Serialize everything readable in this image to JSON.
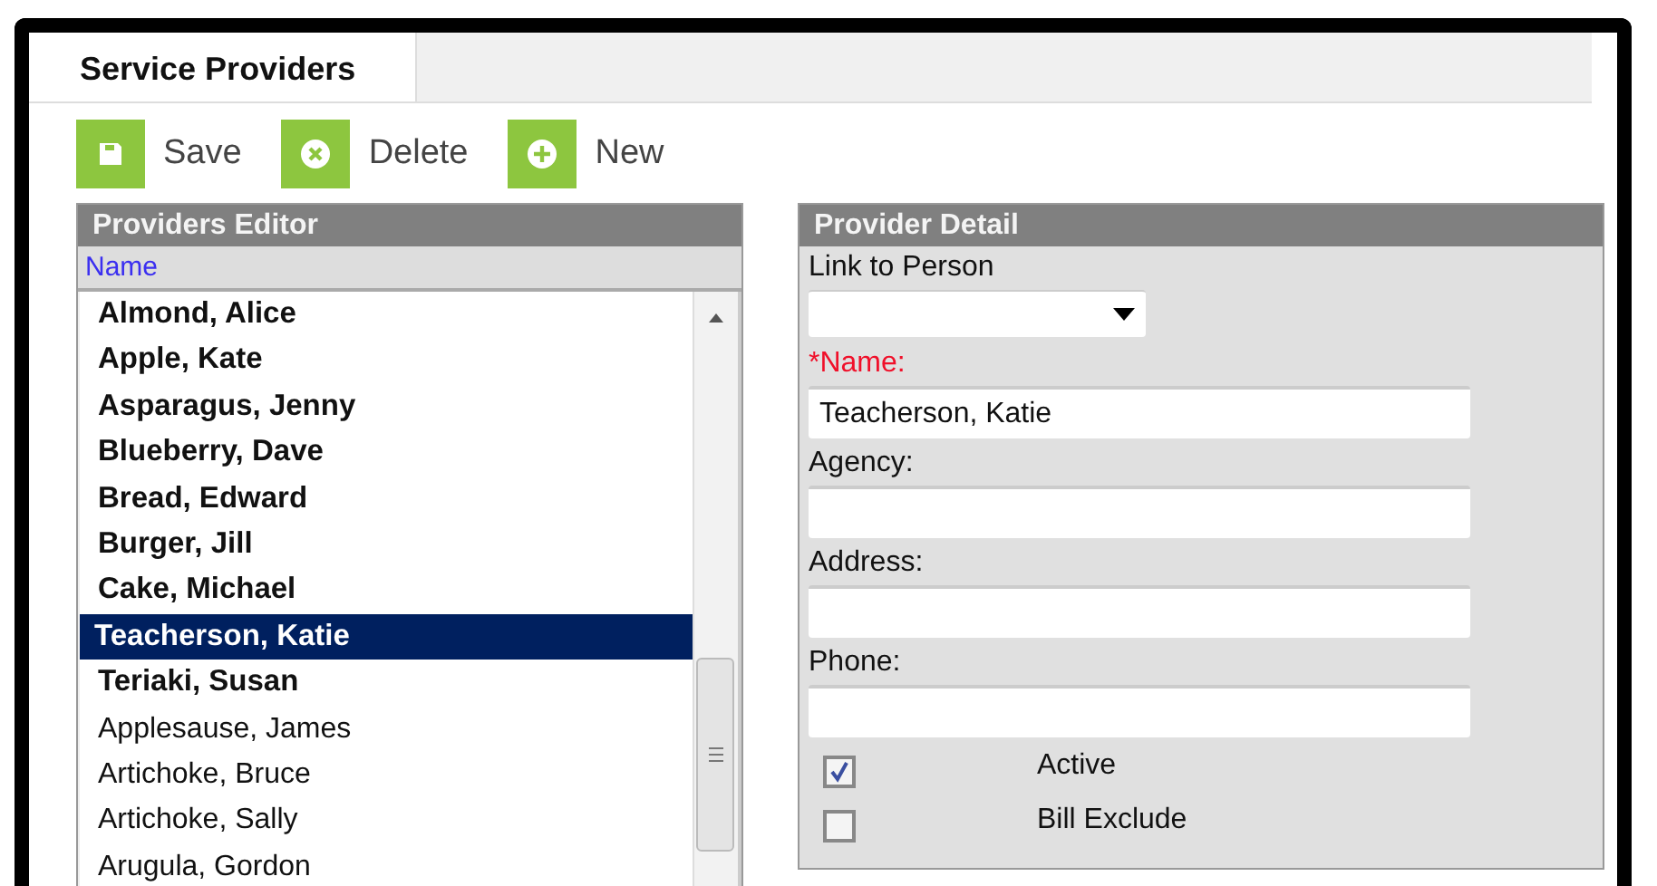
{
  "tabs": [
    {
      "label": "Service Providers",
      "selected": true
    }
  ],
  "toolbar": [
    {
      "label": "Save",
      "kind": "save"
    },
    {
      "label": "Delete",
      "kind": "delete"
    },
    {
      "label": "New",
      "kind": "new"
    }
  ],
  "providers_editor": {
    "title": "Providers Editor",
    "column": "Name",
    "rows": [
      {
        "name": "Almond, Alice",
        "kind": "bold",
        "selected": false
      },
      {
        "name": "Apple, Kate",
        "kind": "bold",
        "selected": false
      },
      {
        "name": "Asparagus, Jenny",
        "kind": "bold",
        "selected": false
      },
      {
        "name": "Blueberry, Dave",
        "kind": "bold",
        "selected": false
      },
      {
        "name": "Bread, Edward",
        "kind": "bold",
        "selected": false
      },
      {
        "name": "Burger, Jill",
        "kind": "bold",
        "selected": false
      },
      {
        "name": "Cake, Michael",
        "kind": "bold",
        "selected": false
      },
      {
        "name": "Teacherson, Katie",
        "kind": "bold",
        "selected": true
      },
      {
        "name": "Teriaki, Susan",
        "kind": "bold",
        "selected": false
      },
      {
        "name": "Applesause, James",
        "kind": "plain",
        "selected": false
      },
      {
        "name": "Artichoke, Bruce",
        "kind": "plain",
        "selected": false
      },
      {
        "name": "Artichoke, Sally",
        "kind": "plain",
        "selected": false
      },
      {
        "name": "Arugula, Gordon",
        "kind": "plain",
        "selected": false
      }
    ]
  },
  "provider_detail": {
    "title": "Provider Detail",
    "fields": [
      {
        "label": "Link to Person",
        "kind": "dropdown",
        "required": false
      },
      {
        "label": "*Name:",
        "kind": "text",
        "required": true,
        "value": "Teacherson, Katie"
      },
      {
        "label": "Agency:",
        "kind": "text",
        "required": false
      },
      {
        "label": "Address:",
        "kind": "text",
        "required": false
      },
      {
        "label": "Phone:",
        "kind": "text",
        "required": false
      }
    ],
    "checkboxes": [
      {
        "label": "Active",
        "checked": true
      },
      {
        "label": "Bill Exclude",
        "checked": false
      }
    ]
  }
}
